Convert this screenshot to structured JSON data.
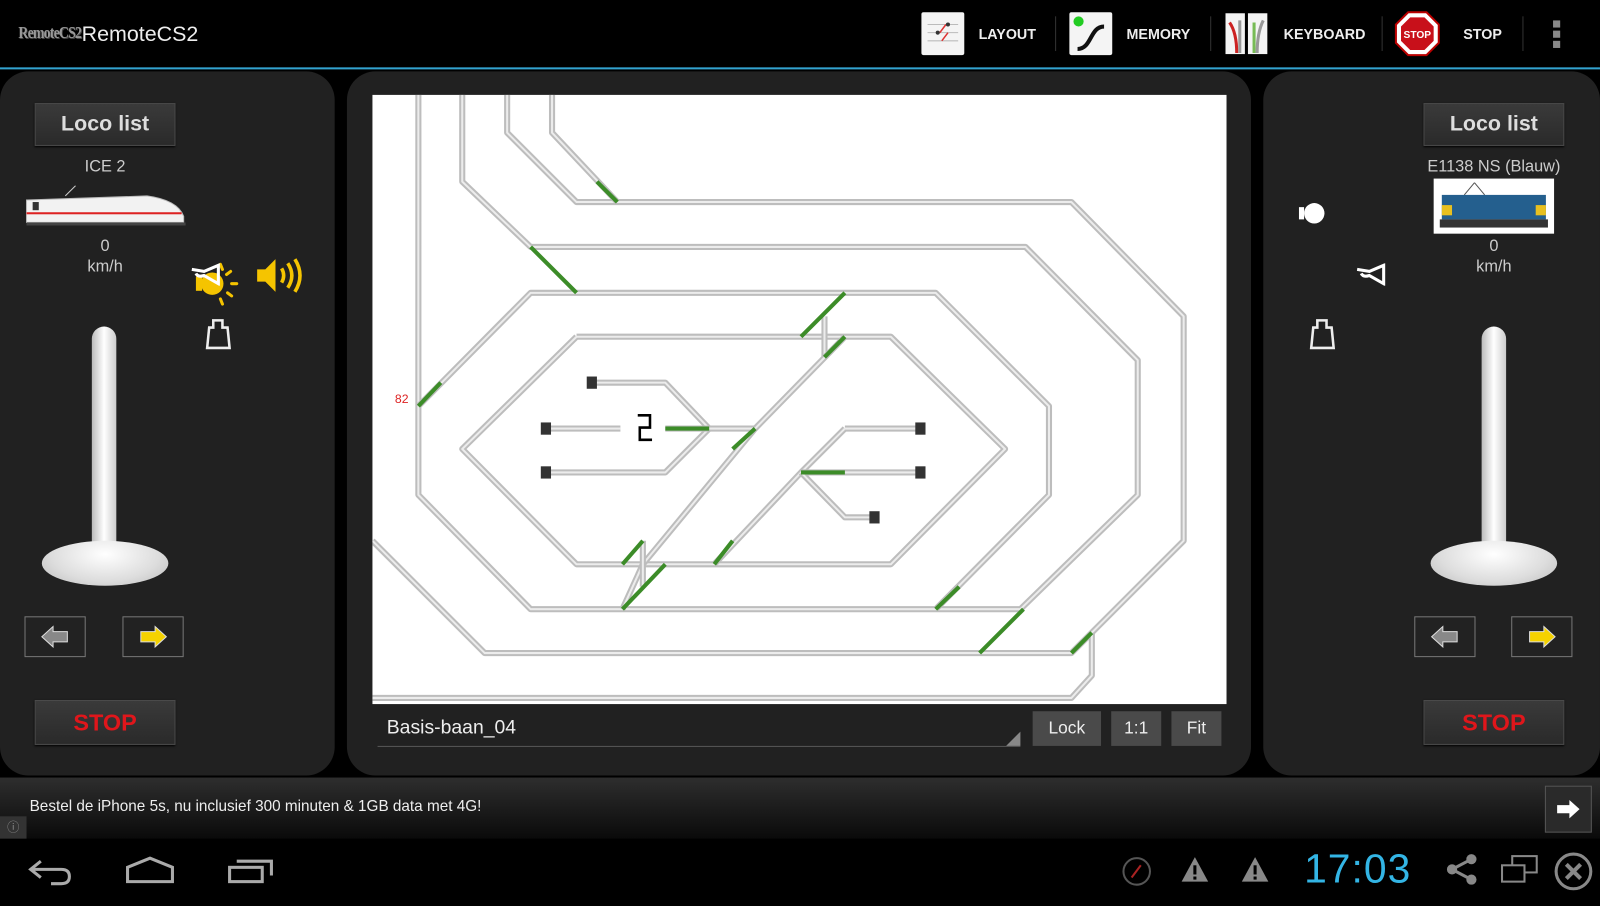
{
  "app": {
    "logo_text": "RemoteCS2",
    "title": "RemoteCS2"
  },
  "actions": [
    {
      "label": "LAYOUT",
      "icon": "layout-icon"
    },
    {
      "label": "MEMORY",
      "icon": "memory-icon"
    },
    {
      "label": "KEYBOARD",
      "icon": "keyboard-icon"
    },
    {
      "label": "STOP",
      "icon": "stop-sign-icon",
      "icon_text": "STOP"
    }
  ],
  "left_loco": {
    "loco_list_label": "Loco list",
    "name": "ICE 2",
    "speed": "0",
    "speed_unit": "km/h",
    "speed_level": 0,
    "light_on": true,
    "sound_on": true,
    "direction": "forward",
    "stop_label": "STOP"
  },
  "right_loco": {
    "loco_list_label": "Loco list",
    "name": "E1138 NS (Blauw)",
    "speed": "0",
    "speed_unit": "km/h",
    "speed_level": 0,
    "light_on": false,
    "direction": "forward",
    "stop_label": "STOP"
  },
  "layout": {
    "name": "Basis-baan_04",
    "block_label": "82",
    "lock_label": "Lock",
    "one_to_one_label": "1:1",
    "fit_label": "Fit",
    "track_color": "#bdbdbd",
    "switch_color": "#3c8c28"
  },
  "ad": {
    "text": "Bestel de iPhone 5s, nu inclusief 300 minuten & 1GB data met 4G!"
  },
  "statusbar": {
    "time": "17:03",
    "accent": "#33b5e5"
  }
}
